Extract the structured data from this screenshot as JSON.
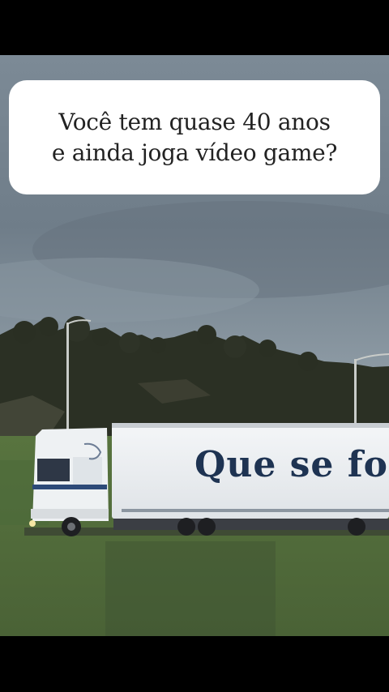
{
  "caption": {
    "line1": "Você tem quase 40 anos",
    "line2": "e ainda joga vídeo game?"
  },
  "truck": {
    "trailer_text": "Que se fo"
  },
  "colors": {
    "sky": "#7d8b97",
    "trees": "#2c3124",
    "grass": "#4f6a3d",
    "trailer": "#f2f4f6",
    "trailer_text": "#1e3352",
    "cab": "#eef1f3",
    "cab_stripe": "#2d4a78"
  }
}
